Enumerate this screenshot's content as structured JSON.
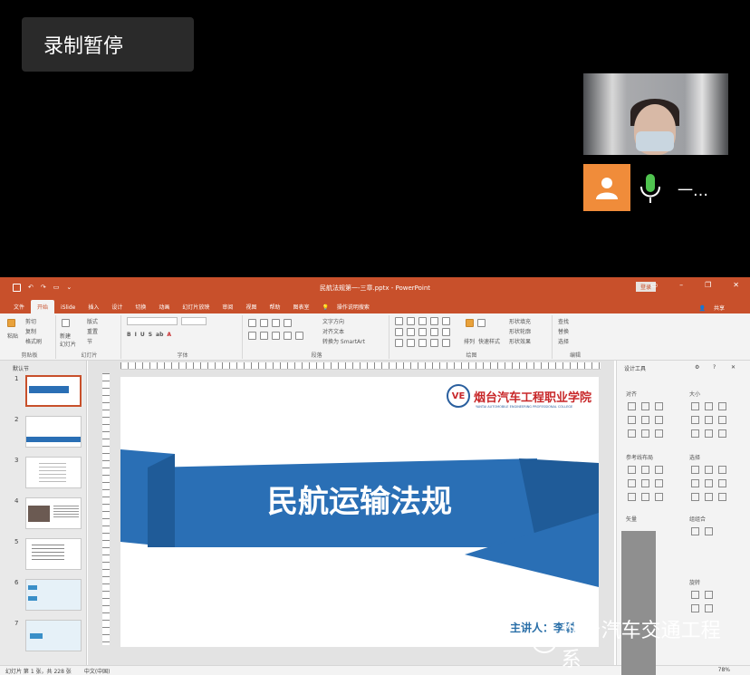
{
  "meeting": {
    "record_button": "录制暂停",
    "participant_name": "一…"
  },
  "ppt": {
    "window_title": "民航法规第一-三章.pptx - PowerPoint",
    "login_button": "登录",
    "tabs": [
      "文件",
      "开始",
      "iSlide",
      "插入",
      "设计",
      "切换",
      "动画",
      "幻灯片放映",
      "审阅",
      "视图",
      "帮助",
      "图表室"
    ],
    "tell_me": "操作说明搜索",
    "share": "共享",
    "ribbon": {
      "paste": "粘贴",
      "cut": "剪切",
      "copy": "复制",
      "format_painter": "格式刷",
      "clipboard": "剪贴板",
      "new_slide": "新建\n幻灯片",
      "layout": "版式",
      "reset": "重置",
      "section": "节",
      "slides": "幻灯片",
      "font": "字体",
      "paragraph": "段落",
      "text_direction": "文字方向",
      "align_text": "对齐文本",
      "convert_smartart": "转换为 SmartArt",
      "drawing": "绘图",
      "arrange": "排列",
      "quick_styles": "快速样式",
      "shape_fill": "形状填充",
      "shape_outline": "形状轮廓",
      "shape_effects": "形状效果",
      "find": "查找",
      "replace": "替换",
      "select": "选择",
      "editing": "编辑"
    },
    "slides_pane": {
      "section": "默认节",
      "numbers": [
        "1",
        "2",
        "3",
        "4",
        "5",
        "6",
        "7"
      ]
    },
    "slide": {
      "title": "民航运输法规",
      "lecturer": "主讲人：李聪",
      "logo_cn": "烟台汽车工程职业学院",
      "logo_en": "YANTAI AUTOMOBILE ENGINEERING PROFESSIONAL COLLEGE"
    },
    "design_pane": {
      "header": "设计工具",
      "align": "对齐",
      "size": "大小",
      "ref_layout": "参考线布局",
      "select": "选择",
      "shape": "矢量",
      "group": "组组合",
      "rotate": "旋转"
    },
    "status": {
      "slide_info": "幻灯片 第 1 张，共 228 张",
      "language": "中文(中国)",
      "zoom": "78%"
    }
  },
  "watermark": "烟台汽车交通工程系",
  "colors": {
    "ppt_orange": "#c8502b",
    "slide_blue": "#2a6fb5",
    "avatar_orange": "#f08c3a"
  }
}
